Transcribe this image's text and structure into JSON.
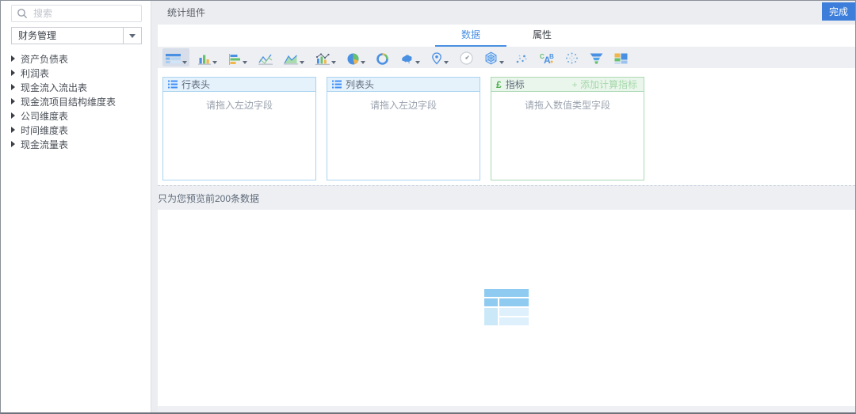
{
  "header": {
    "title": "统计组件",
    "done_button": "完成"
  },
  "sidebar": {
    "search": {
      "placeholder": "搜索"
    },
    "category_select": {
      "value": "财务管理"
    },
    "tables": [
      "资产负债表",
      "利润表",
      "现金流入流出表",
      "现金流项目结构维度表",
      "公司维度表",
      "时间维度表",
      "现金流量表"
    ]
  },
  "tabs": {
    "data": "数据",
    "properties": "属性"
  },
  "toolbar": {
    "selected": "table",
    "chart_types": [
      "table",
      "column-chart",
      "bar-chart",
      "line-chart",
      "area-chart",
      "combo-chart",
      "pie-chart",
      "donut-chart",
      "china-map",
      "pin-map",
      "gauge",
      "radar-chart",
      "scatter-chart",
      "word-cloud",
      "sphere-scatter",
      "funnel-chart",
      "dashboard-blocks"
    ]
  },
  "drop_zones": {
    "row_header": {
      "title": "行表头",
      "placeholder": "请拖入左边字段"
    },
    "column_header": {
      "title": "列表头",
      "placeholder": "请拖入左边字段"
    },
    "measures": {
      "title": "指标",
      "icon_glyph": "£",
      "add_button": "+ 添加计算指标",
      "placeholder": "请拖入数值类型字段"
    }
  },
  "preview": {
    "notice": "只为您预览前200条数据"
  },
  "colors": {
    "accent_blue": "#4a90e2",
    "button_blue": "#3d7eda",
    "green": "#4cae4c",
    "orange": "#f0b64a",
    "panel_blue_border": "#a9d3f0",
    "panel_green_border": "#abd9b3"
  }
}
